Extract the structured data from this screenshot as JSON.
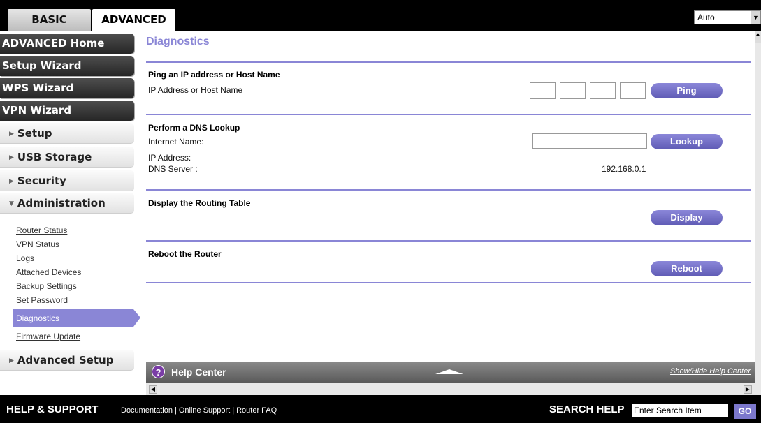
{
  "tabs": {
    "basic": "BASIC",
    "advanced": "ADVANCED"
  },
  "language_select": {
    "value": "Auto"
  },
  "sidebar": {
    "dark_buttons": [
      "ADVANCED Home",
      "Setup Wizard",
      "WPS Wizard",
      "VPN Wizard"
    ],
    "sections": {
      "setup": "Setup",
      "usb_storage": "USB Storage",
      "security": "Security",
      "administration": "Administration",
      "advanced_setup": "Advanced Setup"
    },
    "admin_links": [
      "Router Status",
      "VPN Status",
      "Logs",
      "Attached Devices",
      "Backup Settings",
      "Set Password",
      "Diagnostics",
      "Firmware Update"
    ]
  },
  "main": {
    "title": "Diagnostics",
    "ping": {
      "heading": "Ping an IP address or Host Name",
      "label": "IP Address or Host Name",
      "button": "Ping"
    },
    "dns": {
      "heading": "Perform a DNS Lookup",
      "internet_name_label": "Internet Name:",
      "ip_address_label": "IP Address:",
      "dns_server_label": "DNS Server :",
      "dns_server_value": "192.168.0.1",
      "button": "Lookup"
    },
    "routing": {
      "heading": "Display the Routing Table",
      "button": "Display"
    },
    "reboot": {
      "heading": "Reboot the Router",
      "button": "Reboot"
    }
  },
  "help_center": {
    "title": "Help Center",
    "toggle": "Show/Hide Help Center"
  },
  "footer": {
    "title": "HELP & SUPPORT",
    "links": [
      "Documentation",
      "Online Support",
      "Router FAQ"
    ],
    "search_label": "SEARCH HELP",
    "search_placeholder": "Enter Search Item",
    "go": "GO"
  },
  "colors": {
    "accent": "#8a86d6",
    "button": "#6f6bc4"
  }
}
